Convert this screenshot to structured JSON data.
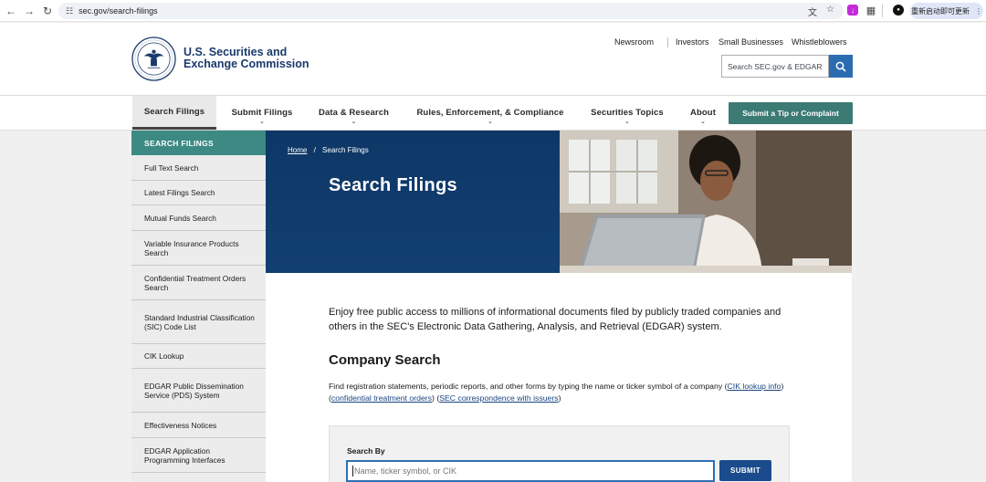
{
  "browser": {
    "url": "sec.gov/search-filings",
    "update_label": "重新启动即可更新"
  },
  "header": {
    "agency_line1": "U.S. Securities and",
    "agency_line2": "Exchange Commission",
    "utility_links": [
      "Newsroom",
      "Investors",
      "Small Businesses",
      "Whistleblowers"
    ],
    "search_placeholder": "Search SEC.gov & EDGAR"
  },
  "mainnav": {
    "items": [
      {
        "label": "Search Filings",
        "active": true
      },
      {
        "label": "Submit Filings"
      },
      {
        "label": "Data & Research"
      },
      {
        "label": "Rules, Enforcement, & Compliance"
      },
      {
        "label": "Securities Topics"
      },
      {
        "label": "About"
      }
    ],
    "tip_button": "Submit a Tip or Complaint"
  },
  "sidebar": {
    "heading": "SEARCH FILINGS",
    "items": [
      "Full Text Search",
      "Latest Filings Search",
      "Mutual Funds Search",
      "Variable Insurance Products Search",
      "Confidential Treatment Orders Search",
      "Standard Industrial Classification (SIC) Code List",
      "CIK Lookup",
      "EDGAR Public Dissemination Service (PDS) System",
      "Effectiveness Notices",
      "EDGAR Application Programming Interfaces"
    ]
  },
  "hero": {
    "breadcrumb_home": "Home",
    "breadcrumb_sep": "/",
    "breadcrumb_current": "Search Filings",
    "title": "Search Filings"
  },
  "main": {
    "intro": "Enjoy free public access to millions of informational documents filed by publicly traded companies and others in the SEC's Electronic Data Gathering, Analysis, and Retrieval (EDGAR) system.",
    "company_search_heading": "Company Search",
    "desc_text": "Find registration statements, periodic reports, and other forms by typing the name or ticker symbol of a company (",
    "link_cik": "CIK lookup info",
    "link_confidential": "confidential treatment orders",
    "link_correspondence": "SEC correspondence with issuers",
    "search_label": "Search By",
    "search_placeholder": "Name, ticker symbol, or CIK",
    "submit_label": "SUBMIT"
  },
  "colors": {
    "brand_navy": "#1a3a6c",
    "teal": "#3c8a83",
    "hero_blue": "#0f3a6b",
    "link_blue": "#1a4480"
  }
}
